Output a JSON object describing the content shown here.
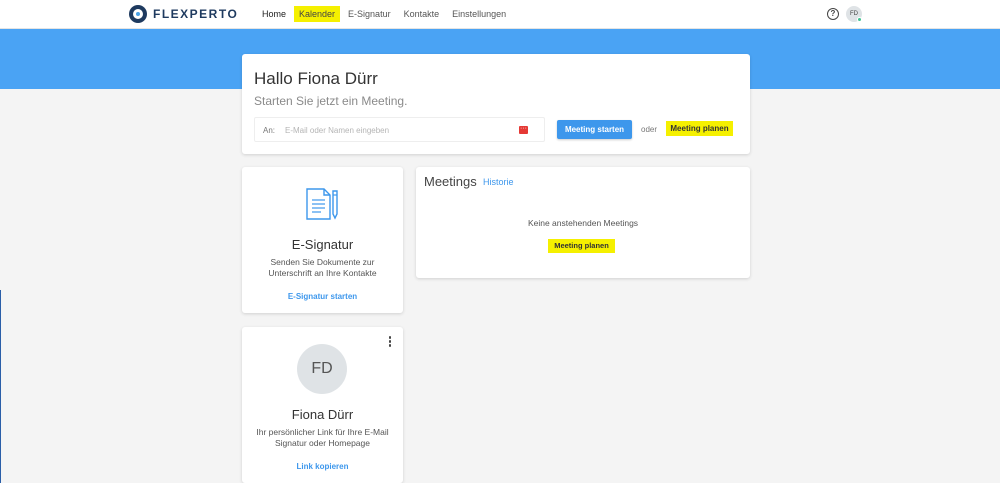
{
  "app": {
    "logo_text": "FLEXPERTO",
    "accent_color": "#4aa3f4",
    "highlight_color": "#f5f000",
    "link_color": "#3d97ec"
  },
  "nav": {
    "items": [
      {
        "label": "Home",
        "active": true,
        "highlighted": false
      },
      {
        "label": "Kalender",
        "active": false,
        "highlighted": true
      },
      {
        "label": "E-Signatur",
        "active": false,
        "highlighted": false
      },
      {
        "label": "Kontakte",
        "active": false,
        "highlighted": false
      },
      {
        "label": "Einstellungen",
        "active": false,
        "highlighted": false
      }
    ]
  },
  "header": {
    "help_icon": "?",
    "user_initials": "FD"
  },
  "greeting": {
    "title": "Hallo Fiona Dürr",
    "subtitle": "Starten Sie jetzt ein Meeting.",
    "to_label": "An:",
    "input_placeholder": "E-Mail oder Namen eingeben",
    "input_value": "",
    "start_button": "Meeting starten",
    "or_text": "oder",
    "plan_button": "Meeting planen"
  },
  "esignature_card": {
    "icon": "document-pen-icon",
    "title": "E-Signatur",
    "description": "Senden Sie Dokumente zur Unterschrift an Ihre Kontakte",
    "link": "E-Signatur starten"
  },
  "meetings_card": {
    "title": "Meetings",
    "history_link": "Historie",
    "empty_text": "Keine anstehenden Meetings",
    "plan_button": "Meeting planen"
  },
  "profile_card": {
    "initials": "FD",
    "name": "Fiona Dürr",
    "description": "Ihr persönlicher Link für Ihre E-Mail Signatur oder Homepage",
    "link": "Link kopieren"
  }
}
